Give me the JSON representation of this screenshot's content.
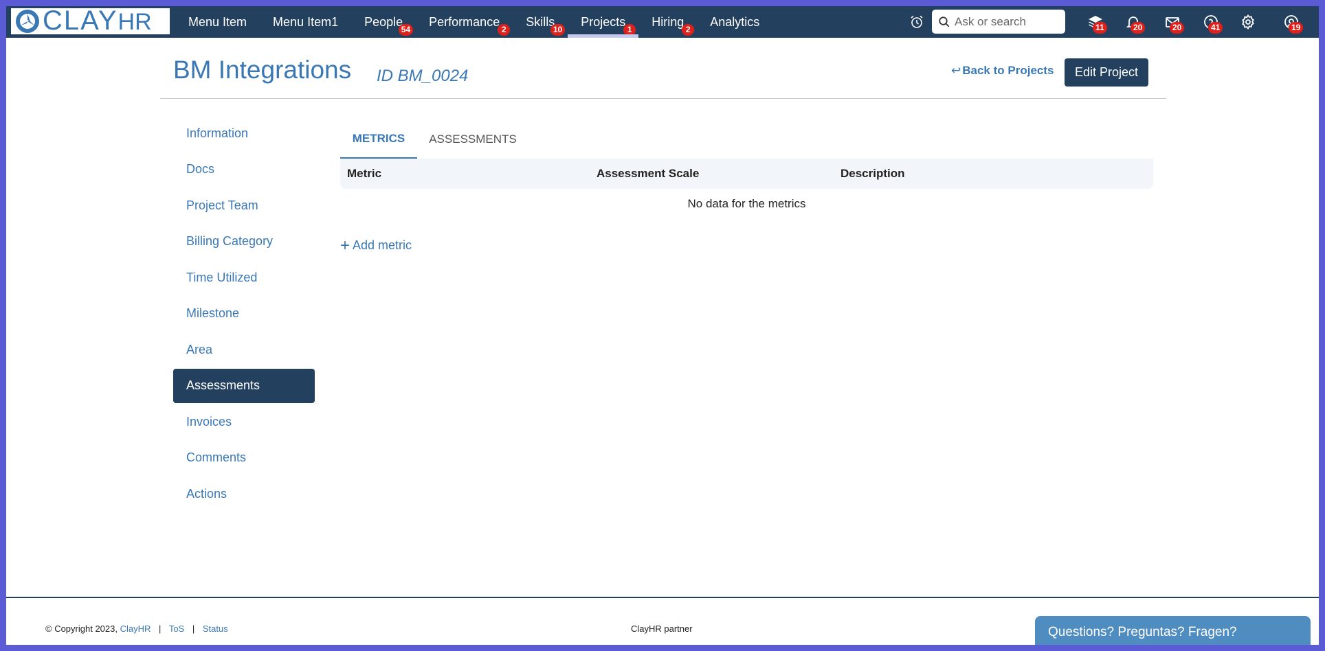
{
  "logo": {
    "text_main": "CLAY",
    "text_sub": "HR"
  },
  "nav": {
    "items": [
      {
        "label": "Menu Item",
        "badge": ""
      },
      {
        "label": "Menu Item1",
        "badge": ""
      },
      {
        "label": "People",
        "badge": "54"
      },
      {
        "label": "Performance",
        "badge": "2"
      },
      {
        "label": "Skills",
        "badge": "10"
      },
      {
        "label": "Projects",
        "badge": "1"
      },
      {
        "label": "Hiring",
        "badge": "2"
      },
      {
        "label": "Analytics",
        "badge": ""
      }
    ],
    "active": "Projects"
  },
  "search": {
    "placeholder": "Ask or search"
  },
  "tools": {
    "icons": [
      "alarm-clock-icon",
      "layers-icon",
      "bell-icon",
      "mail-icon",
      "help-icon",
      "gear-icon",
      "support-icon"
    ],
    "badges": {
      "layers": "11",
      "bell": "20",
      "mail": "20",
      "help": "41",
      "support": "19"
    }
  },
  "header": {
    "title": "BM Integrations",
    "id_label": "ID BM_0024",
    "back_label": "Back to Projects",
    "edit_label": "Edit Project"
  },
  "sidebar": {
    "items": [
      {
        "label": "Information"
      },
      {
        "label": "Docs"
      },
      {
        "label": "Project Team"
      },
      {
        "label": "Billing Category"
      },
      {
        "label": "Time Utilized"
      },
      {
        "label": "Milestone"
      },
      {
        "label": "Area"
      },
      {
        "label": "Assessments"
      },
      {
        "label": "Invoices"
      },
      {
        "label": "Comments"
      },
      {
        "label": "Actions"
      }
    ],
    "active": "Assessments"
  },
  "tabs": [
    {
      "label": "METRICS"
    },
    {
      "label": "ASSESSMENTS"
    }
  ],
  "table": {
    "columns": [
      "Metric",
      "Assessment Scale",
      "Description"
    ],
    "empty_message": "No data for the metrics"
  },
  "add_metric_label": "Add metric",
  "footer": {
    "copyright": "© Copyright 2023,",
    "brand_link": "ClayHR",
    "tos": "ToS",
    "status": "Status",
    "center": "ClayHR partner"
  },
  "chat": {
    "label": "Questions? Preguntas? Fragen?"
  },
  "colors": {
    "navy": "#23405e",
    "accent": "#3a78b5",
    "badge": "#e0201b",
    "chat": "#4f8cc0"
  }
}
